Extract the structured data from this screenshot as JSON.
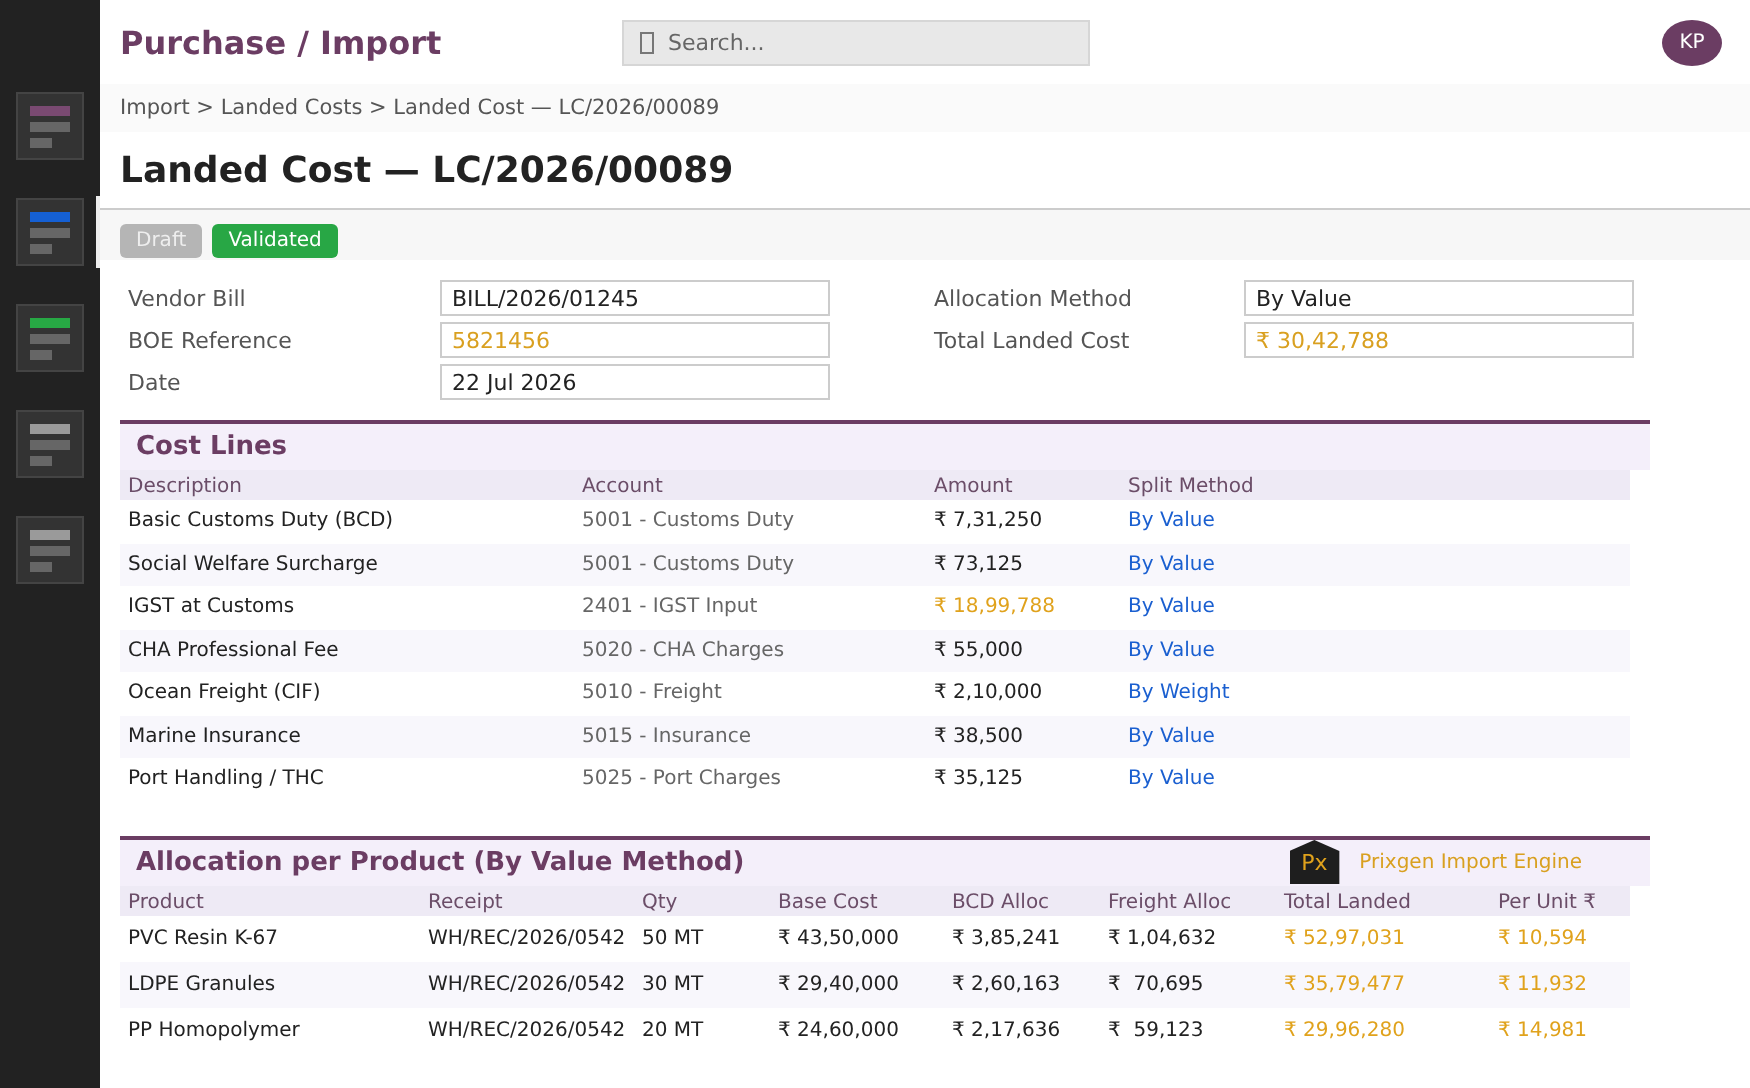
{
  "sidebar": {
    "items": [
      {
        "color": "#7a4a72",
        "selected": false
      },
      {
        "color": "#1560d4",
        "selected": true
      },
      {
        "color": "#27a844",
        "selected": false
      },
      {
        "color": "#9a9a9a",
        "selected": false
      },
      {
        "color": "#9a9a9a",
        "selected": false
      }
    ]
  },
  "header": {
    "title": "Purchase / Import",
    "search": {
      "placeholder": "Search..."
    },
    "avatar": "KP"
  },
  "breadcrumb": "Import > Landed Costs > Landed Cost — LC/2026/00089",
  "title": "Landed Cost — LC/2026/00089",
  "statuses": [
    {
      "label": "Draft",
      "selected": false
    },
    {
      "label": "Validated",
      "selected": true
    }
  ],
  "form": {
    "left": [
      {
        "label": "Vendor Bill",
        "value": "BILL/2026/01245",
        "highlighted": false
      },
      {
        "label": "BOE Reference",
        "value": "5821456",
        "highlighted": true
      },
      {
        "label": "Date",
        "value": "22 Jul 2026",
        "highlighted": false
      }
    ],
    "right": [
      {
        "label": "Allocation Method",
        "value": "By Value",
        "highlighted": false
      },
      {
        "label": "Total Landed Cost",
        "value": "₹ 30,42,788",
        "highlighted": true
      }
    ]
  },
  "cost_lines": {
    "title": "Cost Lines",
    "columns": [
      "Description",
      "Account",
      "Amount",
      "Split Method"
    ],
    "rows": [
      {
        "description": "Basic Customs Duty (BCD)",
        "account": "5001 - Customs Duty",
        "amount": "₹ 7,31,250",
        "amount_highlighted": false,
        "split_method": "By Value"
      },
      {
        "description": "Social Welfare Surcharge",
        "account": "5001 - Customs Duty",
        "amount": "₹ 73,125",
        "amount_highlighted": false,
        "split_method": "By Value"
      },
      {
        "description": "IGST at Customs",
        "account": "2401 - IGST Input",
        "amount": "₹ 18,99,788",
        "amount_highlighted": true,
        "split_method": "By Value"
      },
      {
        "description": "CHA Professional Fee",
        "account": "5020 - CHA Charges",
        "amount": "₹ 55,000",
        "amount_highlighted": false,
        "split_method": "By Value"
      },
      {
        "description": "Ocean Freight (CIF)",
        "account": "5010 - Freight",
        "amount": "₹ 2,10,000",
        "amount_highlighted": false,
        "split_method": "By Weight"
      },
      {
        "description": "Marine Insurance",
        "account": "5015 - Insurance",
        "amount": "₹ 38,500",
        "amount_highlighted": false,
        "split_method": "By Value"
      },
      {
        "description": "Port Handling / THC",
        "account": "5025 - Port Charges",
        "amount": "₹ 35,125",
        "amount_highlighted": false,
        "split_method": "By Value"
      }
    ]
  },
  "allocation": {
    "title": "Allocation per Product (By Value Method)",
    "logo": {
      "mark": "Px",
      "name": "Prixgen Import Engine"
    },
    "columns": [
      {
        "label": "Product",
        "highlighted": false
      },
      {
        "label": "Receipt",
        "highlighted": false
      },
      {
        "label": "Qty",
        "highlighted": false
      },
      {
        "label": "Base Cost",
        "highlighted": false
      },
      {
        "label": "BCD Alloc",
        "highlighted": false
      },
      {
        "label": "Freight Alloc",
        "highlighted": false
      },
      {
        "label": "Total Landed",
        "highlighted": true
      },
      {
        "label": "Per Unit ₹",
        "highlighted": true
      }
    ],
    "rows": [
      [
        "PVC Resin K-67",
        "WH/REC/2026/0542",
        "50 MT",
        "₹ 43,50,000",
        "₹ 3,85,241",
        "₹ 1,04,632",
        "₹ 52,97,031",
        "₹ 10,594"
      ],
      [
        "LDPE Granules",
        "WH/REC/2026/0542",
        "30 MT",
        "₹ 29,40,000",
        "₹ 2,60,163",
        "₹  70,695",
        "₹ 35,79,477",
        "₹ 11,932"
      ],
      [
        "PP Homopolymer",
        "WH/REC/2026/0542",
        "20 MT",
        "₹ 24,60,000",
        "₹ 2,17,636",
        "₹  59,123",
        "₹ 29,96,280",
        "₹ 14,981"
      ]
    ]
  }
}
